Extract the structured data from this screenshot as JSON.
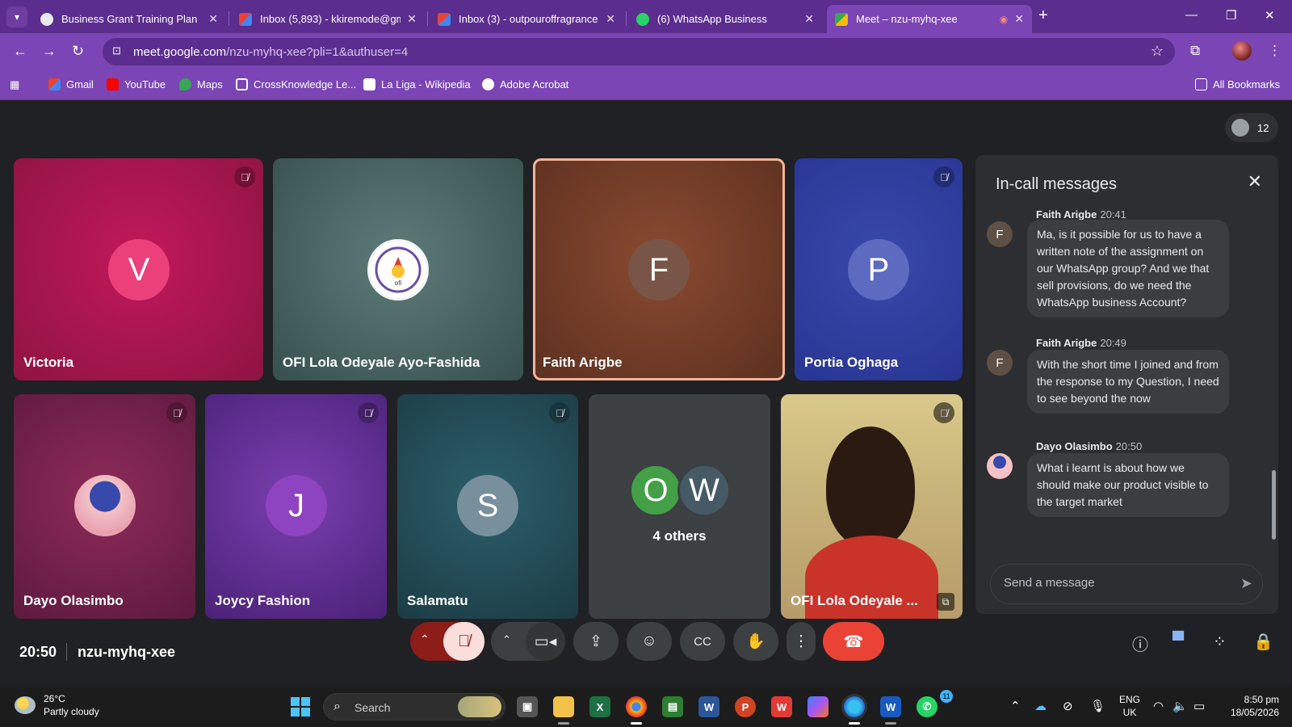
{
  "browser": {
    "tabs": [
      {
        "label": "Business Grant Training Plan",
        "color": "#9aa0a6"
      },
      {
        "label": "Inbox (5,893) - kkiremode@gm",
        "color": "#ea4335"
      },
      {
        "label": "Inbox (3) - outpouroffragrance",
        "color": "#ea4335"
      },
      {
        "label": "(6) WhatsApp Business",
        "color": "#25d366"
      },
      {
        "label": "Meet – nzu-myhq-xee",
        "color": "#34a853"
      }
    ],
    "url_main": "meet.google.com",
    "url_rest": "/nzu-myhq-xee?pli=1&authuser=4",
    "bookmarks": [
      "Gmail",
      "YouTube",
      "Maps",
      "CrossKnowledge Le...",
      "La Liga - Wikipedia",
      "Adobe Acrobat"
    ],
    "all_bookmarks": "All Bookmarks"
  },
  "meet": {
    "participant_count": "12",
    "tiles": [
      {
        "name": "Victoria",
        "initial": "V"
      },
      {
        "name": "OFI Lola Odeyale Ayo-Fashida"
      },
      {
        "name": "Faith Arigbe",
        "initial": "F"
      },
      {
        "name": "Portia Oghaga",
        "initial": "P"
      },
      {
        "name": "Dayo Olasimbo"
      },
      {
        "name": "Joycy Fashion",
        "initial": "J"
      },
      {
        "name": "Salamatu",
        "initial": "S"
      },
      {
        "name": "4 others",
        "initials": [
          "O",
          "W"
        ]
      },
      {
        "name": "OFI Lola Odeyale ..."
      }
    ],
    "meeting_time": "20:50",
    "meeting_code": "nzu-myhq-xee"
  },
  "chat": {
    "title": "In-call messages",
    "messages": [
      {
        "sender": "Faith Arigbe",
        "time": "20:41",
        "initial": "F",
        "text": "Ma, is it possible for us to have a written note of the assignment on our WhatsApp group? And we that sell provisions, do we need the WhatsApp business Account?"
      },
      {
        "sender": "Faith Arigbe",
        "time": "20:49",
        "initial": "F",
        "text": "With the short time I joined and from the response to my Question, I need to see beyond the now"
      },
      {
        "sender": "Dayo Olasimbo",
        "time": "20:50",
        "text": "What i learnt is about how we should make our product visible to the target market"
      }
    ],
    "input_placeholder": "Send a message"
  },
  "taskbar": {
    "temperature": "26°C",
    "weather": "Partly cloudy",
    "search": "Search",
    "lang_line1": "ENG",
    "lang_line2": "UK",
    "clock_time": "8:50 pm",
    "clock_date": "18/05/2026",
    "whatsapp_badge": "11"
  },
  "colors": {
    "browser_frame": "#5b2d8e",
    "browser_toolbar": "#7b45b5",
    "meet_background": "#202124",
    "hangup": "#ea4335",
    "mic_off": "#8c1d18"
  }
}
